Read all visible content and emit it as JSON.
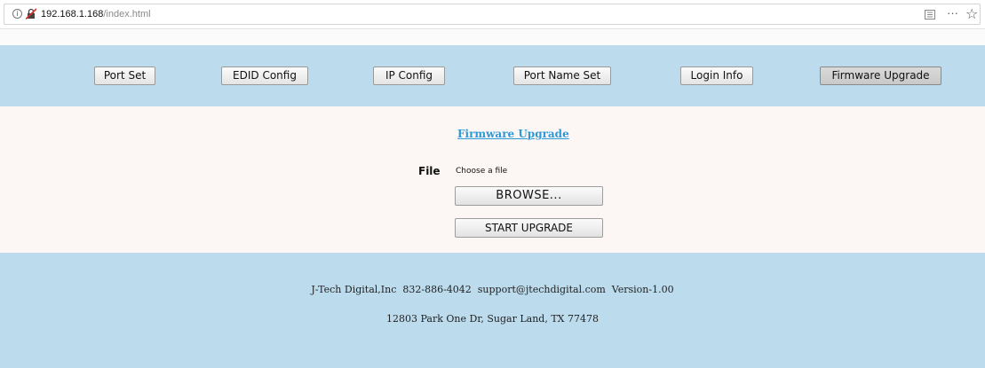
{
  "browser": {
    "url_host": "192.168.1.168",
    "url_path": "/index.html",
    "info_glyph": "i",
    "icons": [
      "info-icon",
      "insecure-lock-icon",
      "reader-icon",
      "more-icon",
      "star-icon"
    ]
  },
  "nav": {
    "buttons": [
      {
        "label": "Port Set"
      },
      {
        "label": "EDID Config"
      },
      {
        "label": "IP Config"
      },
      {
        "label": "Port Name Set"
      },
      {
        "label": "Login Info"
      },
      {
        "label": "Firmware Upgrade"
      }
    ],
    "active_index": 5
  },
  "main": {
    "title": "Firmware Upgrade",
    "file_label": "File",
    "file_status": "Choose a file",
    "browse_label": "BROWSE...",
    "upgrade_label": "START UPGRADE"
  },
  "footer": {
    "line1": "J-Tech Digital,Inc  832-886-4042  support@jtechdigital.com  Version-1.00",
    "line2": "12803 Park One Dr, Sugar Land, TX 77478"
  },
  "colors": {
    "band": "#bcdcee",
    "content_bg": "#fcf6f4",
    "link": "#2d9ad7"
  }
}
